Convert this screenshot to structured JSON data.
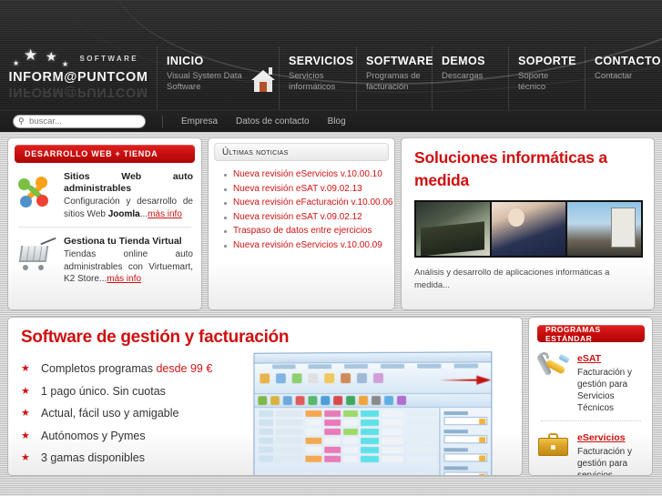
{
  "brand": {
    "name": "INFORM@PUNTCOM",
    "tagline": "SOFTWARE"
  },
  "mainnav": [
    {
      "title": "INICIO",
      "sub": "Visual System Data Software",
      "icon": "house-icon"
    },
    {
      "title": "SERVICIOS",
      "sub": "Servicios informáticos"
    },
    {
      "title": "SOFTWARE",
      "sub": "Programas de facturación"
    },
    {
      "title": "DEMOS",
      "sub": "Descargas"
    },
    {
      "title": "SOPORTE",
      "sub": "Soporte técnico"
    },
    {
      "title": "CONTACTO",
      "sub": "Contactar"
    }
  ],
  "search": {
    "placeholder": "buscar...",
    "value": "",
    "icon": "search-icon"
  },
  "subnav": [
    {
      "label": "Empresa"
    },
    {
      "label": "Datos de contacto"
    },
    {
      "label": "Blog"
    }
  ],
  "left_panel": {
    "header": "DESARROLLO WEB + TIENDA",
    "items": [
      {
        "icon": "joomla-icon",
        "title": "Sitios Web auto administrables",
        "text": "Configuración y desarrollo de sitios Web ",
        "bold": "Joomla",
        "ellipsis": "...",
        "link": "más info"
      },
      {
        "icon": "shopping-cart-icon",
        "title": "Gestiona tu Tienda Virtual",
        "text": "Tiendas online auto administrables con Virtuemart, K2 Store",
        "bold": "",
        "ellipsis": "...",
        "link": "más info"
      }
    ]
  },
  "news_panel": {
    "header": "Últimas noticias",
    "items": [
      "Nueva revisión eServicios v.10.00.10",
      "Nueva revisión eSAT v.09.02.13",
      "Nueva revisión eFacturación v.10.00.06",
      "Nueva revisión eSAT v.09.02.12",
      "Traspaso de datos entre ejercicios",
      "Nueva revisión eServicios v.10.00.09"
    ]
  },
  "banner_panel": {
    "title": "Soluciones informáticas a medida",
    "caption": "Análisis y desarrollo de aplicaciones informáticas a medida...",
    "photos": [
      "hands-on-keyboard-photo",
      "team-with-laptop-photo",
      "office-whiteboard-photo"
    ]
  },
  "main_panel": {
    "title": "Software de gestión y facturación",
    "features": [
      {
        "text": "Completos programas ",
        "highlight": "desde 99 €"
      },
      {
        "text": "1 pago único. Sin cuotas",
        "highlight": ""
      },
      {
        "text": "Actual, fácil uso y amigable",
        "highlight": ""
      },
      {
        "text": "Autónomos y Pymes",
        "highlight": ""
      },
      {
        "text": "3 gamas disponibles",
        "highlight": ""
      }
    ],
    "screenshot_alt": "application-screenshot"
  },
  "side_panel": {
    "header": "PROGRAMAS ESTÁNDAR",
    "products": [
      {
        "icon": "tools-icon",
        "name": "eSAT",
        "desc": "Facturación y gestión para Servicios Técnicos"
      },
      {
        "icon": "briefcase-icon",
        "name": "eServicios",
        "desc": "Facturación y gestión para servicios"
      }
    ]
  },
  "colors": {
    "brand_red": "#cf0f0f",
    "header_dark": "#2b2b2b",
    "page_bg": "#d2d2d2"
  }
}
